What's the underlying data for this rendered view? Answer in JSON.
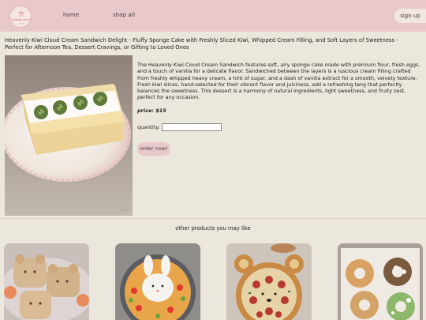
{
  "header": {
    "logo_text": "baking mood",
    "nav": [
      {
        "label": "home"
      },
      {
        "label": "shop all"
      }
    ],
    "signup_label": "sign up"
  },
  "product": {
    "title": "Heavenly Kiwi Cloud Cream Sandwich Delight - Fluffy Sponge Cake with Freshly Sliced Kiwi, Whipped Cream Filling, and Soft Layers of Sweetness - Perfect for Afternoon Tea, Dessert Cravings, or Gifting to Loved Ones",
    "description": "The Heavenly Kiwi Cloud Cream Sandwich features soft, airy sponge cake made with premium flour, fresh eggs, and a touch of vanilla for a delicate flavor. Sandwiched between the layers is a luscious cream filling crafted from freshly whipped heavy cream, a hint of sugar, and a dash of vanilla extract for a smooth, velvety texture. Fresh kiwi slices, hand-selected for their vibrant flavor and juiciness, add a refreshing tang that perfectly balances the sweetness. This dessert is a harmony of natural ingredients, light sweetness, and fruity zest, perfect for any occasion.",
    "price": "price: $15",
    "quantity_label": "quantity:",
    "quantity_value": "",
    "order_label": "order now!"
  },
  "related": {
    "heading": "other products you may like",
    "items": [
      {
        "name": "bear-bread"
      },
      {
        "name": "bunny-rice-bowl"
      },
      {
        "name": "bear-pizza"
      },
      {
        "name": "mochi-donuts"
      }
    ]
  },
  "colors": {
    "header_bg": "#e8c8cb",
    "page_bg": "#ece7dc",
    "button_bg": "#e8c8cb"
  }
}
